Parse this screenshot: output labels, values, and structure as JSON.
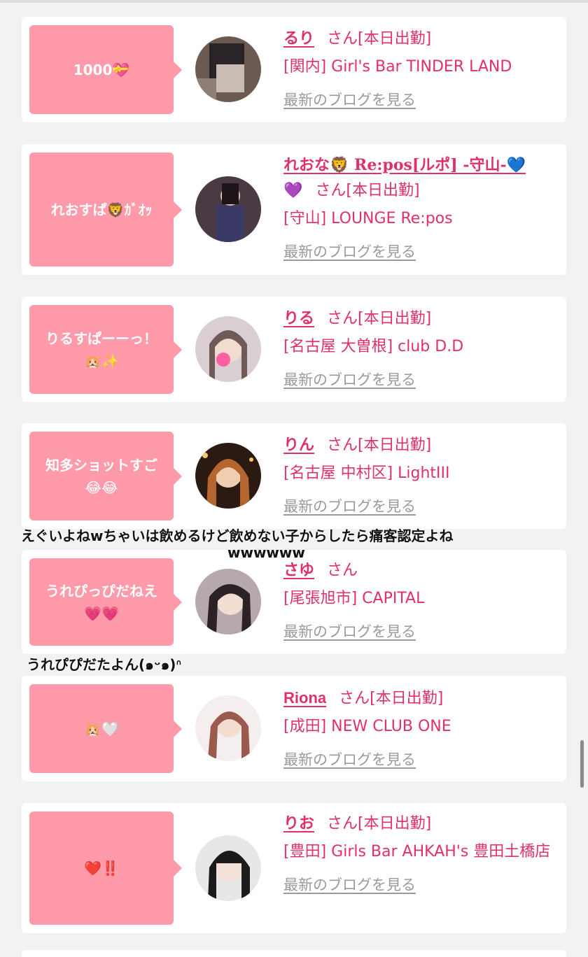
{
  "cards": [
    {
      "bubble": "1000💝",
      "name": "るり",
      "san": "さん[本日出勤]",
      "shop": "[関内] Girl's Bar TINDER LAND",
      "blog": "最新のブログを見る"
    },
    {
      "bubble": "れおすぱ🦁ｶﾞｵｯ",
      "name": "れおな🦁 Re:pos[ルポ] -守山-💙",
      "name2": "💜",
      "san": "さん[本日出勤]",
      "shop": "[守山] LOUNGE Re:pos",
      "blog": "最新のブログを見る"
    },
    {
      "bubble": "りるすぱーーっ！\n🐹✨",
      "name": "りる",
      "san": "さん[本日出勤]",
      "shop": "[名古屋 大曽根] club D.D",
      "blog": "最新のブログを見る"
    },
    {
      "bubble": "知多ショットすご\n😂😂",
      "name": "りん",
      "san": "さん[本日出勤]",
      "shop": "[名古屋 中村区] LightIII",
      "blog": "最新のブログを見る"
    },
    {
      "bubble": "うれぴっぴだねえ\n💗💗",
      "name": "さゆ",
      "san": "さん",
      "shop": "[尾張旭市] CAPITAL",
      "blog": "最新のブログを見る"
    },
    {
      "bubble": "🐹🤍",
      "name": "Riona",
      "san": "さん[本日出勤]",
      "shop": "[成田] NEW CLUB ONE",
      "blog": "最新のブログを見る"
    },
    {
      "bubble": "❤️‼️",
      "name": "りお",
      "san": "さん[本日出勤]",
      "shop": "[豊田] Girls Bar AHKAH's 豊田土橋店",
      "blog": "最新のブログを見る"
    }
  ],
  "overlays": {
    "comment1_line1": "えぐいよねwちゃいは飲めるけど飲めない子からしたら痛客認定よね",
    "comment1_line2": "wwwwww",
    "comment2": "うれぴぴだたよん(๑ᵕ๑)ᐢ"
  },
  "colors": {
    "accent": "#e0306a",
    "bubble": "#ff9aaa",
    "blog_link": "#9a9a9a",
    "background": "#f2f2f2"
  }
}
